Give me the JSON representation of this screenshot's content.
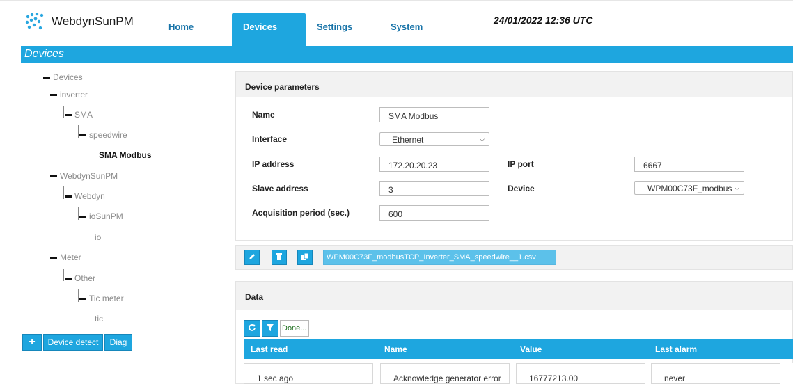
{
  "app": {
    "brand": "WebdynSunPM",
    "accent": "#1ea6df"
  },
  "nav": {
    "home": "Home",
    "devices": "Devices",
    "settings": "Settings",
    "system": "System"
  },
  "datetime": "24/01/2022 12:36 UTC",
  "section_title": "Devices",
  "tree": {
    "root": "Devices",
    "items": [
      {
        "label": "inverter"
      },
      {
        "label": "SMA"
      },
      {
        "label": "speedwire"
      },
      {
        "label": "SMA Modbus",
        "selected": true
      },
      {
        "label": "WebdynSunPM"
      },
      {
        "label": "Webdyn"
      },
      {
        "label": "ioSunPM"
      },
      {
        "label": "io"
      },
      {
        "label": "Meter"
      },
      {
        "label": "Other"
      },
      {
        "label": "Tic meter"
      },
      {
        "label": "tic"
      }
    ],
    "buttons": {
      "add": "+",
      "detect": "Device detect",
      "diag": "Diag"
    }
  },
  "device_params": {
    "title": "Device parameters",
    "name_label": "Name",
    "name_value": "SMA Modbus",
    "interface_label": "Interface",
    "interface_value": "Ethernet",
    "ip_label": "IP address",
    "ip_value": "172.20.20.23",
    "port_label": "IP port",
    "port_value": "6667",
    "slave_label": "Slave address",
    "slave_value": "3",
    "device_label": "Device",
    "device_value": "WPM00C73F_modbus",
    "acq_label": "Acquisition period (sec.)",
    "acq_value": "600",
    "file_name": "WPM00C73F_modbusTCP_Inverter_SMA_speedwire__1.csv"
  },
  "data_panel": {
    "title": "Data",
    "done_label": "Done...",
    "columns": [
      "Last read",
      "Name",
      "Value",
      "Last alarm"
    ],
    "rows": [
      [
        "1 sec ago",
        "Acknowledge generator error",
        "16777213.00",
        "never"
      ]
    ]
  },
  "icons": [
    "webdyn-logo-icon",
    "edit-icon",
    "trash-icon",
    "copy-icon",
    "refresh-icon",
    "filter-icon",
    "chevron-down-icon"
  ]
}
